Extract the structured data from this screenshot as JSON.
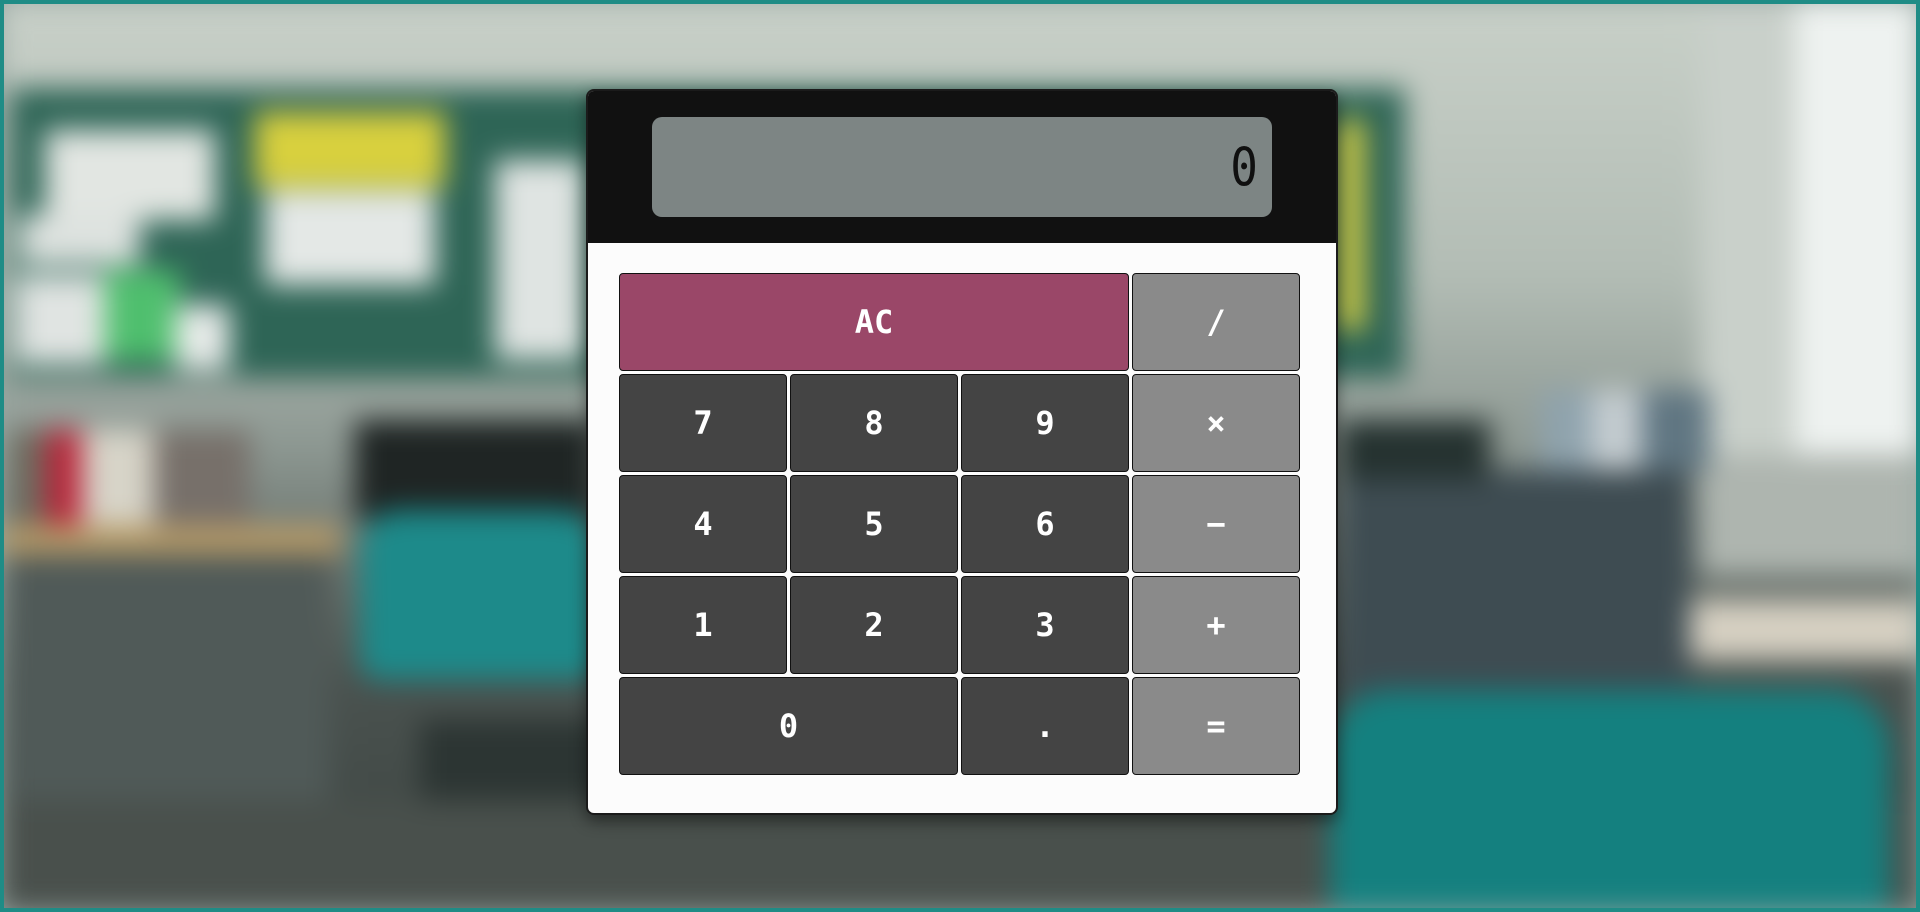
{
  "colors": {
    "display_bg": "#7d8584",
    "display_bezel": "#111111",
    "number_key": "#444444",
    "operator_key": "#8a8a8a",
    "clear_key": "#9a4768",
    "body": "#fcfcfc"
  },
  "display": {
    "value": "0"
  },
  "keys": {
    "clear": "AC",
    "divide": "/",
    "seven": "7",
    "eight": "8",
    "nine": "9",
    "multiply": "×",
    "four": "4",
    "five": "5",
    "six": "6",
    "subtract": "−",
    "one": "1",
    "two": "2",
    "three": "3",
    "add": "+",
    "zero": "0",
    "decimal": ".",
    "equals": "="
  }
}
